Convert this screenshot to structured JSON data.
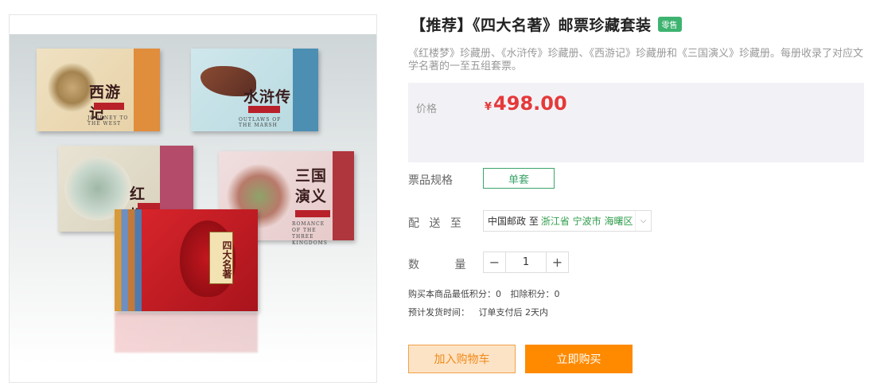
{
  "product": {
    "title": "【推荐】《四大名著》邮票珍藏套装",
    "badge": "零售",
    "description": "《红楼梦》珍藏册、《水浒传》珍藏册、《西游记》珍藏册和《三国演义》珍藏册。每册收录了对应文学名著的一至五组套票。"
  },
  "image": {
    "books": [
      {
        "title": "西游记",
        "subtitle": "JOURNEY TO THE WEST"
      },
      {
        "title": "水浒传",
        "subtitle": "OUTLAWS OF THE MARSH"
      },
      {
        "title": "红楼梦",
        "subtitle": ""
      },
      {
        "title": "三国演义",
        "subtitle": "ROMANCE OF THE THREE KINGDOMS"
      }
    ],
    "box_title": "四大名著"
  },
  "price": {
    "label": "价格",
    "currency": "¥",
    "value": "498.00"
  },
  "spec": {
    "label": "票品规格",
    "option": "单套"
  },
  "shipping": {
    "label": "配 送 至",
    "carrier": "中国邮政 至",
    "location": "浙江省 宁波市 海曙区"
  },
  "quantity": {
    "label": "数 量",
    "minus": "−",
    "value": "1",
    "plus": "+"
  },
  "points": {
    "min_label": "购买本商品最低积分：0",
    "deduct_label": "扣除积分：0"
  },
  "delivery": {
    "label": "预计发货时间：",
    "value": "订单支付后 2天内"
  },
  "actions": {
    "add_to_cart": "加入购物车",
    "buy_now": "立即购买"
  },
  "colors": {
    "price": "#e5393a",
    "accent_green": "#3ca56c",
    "buy_orange": "#ff8a00"
  }
}
